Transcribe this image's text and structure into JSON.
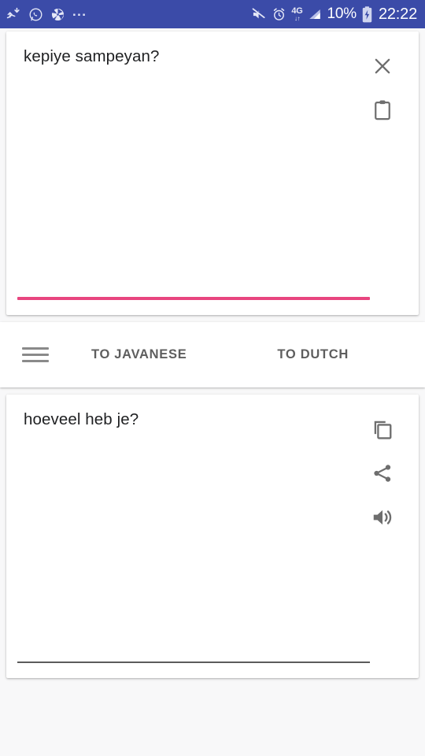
{
  "status_bar": {
    "background_color": "#3b4ba8",
    "left_icons": [
      {
        "name": "data-transfer-icon",
        "glyph": "data-transfer"
      },
      {
        "name": "whatsapp-icon",
        "glyph": "whatsapp"
      },
      {
        "name": "camera-shutter-icon",
        "glyph": "shutter"
      }
    ],
    "overflow_dots": "...",
    "right_icons": [
      {
        "name": "mute-icon",
        "glyph": "mute"
      },
      {
        "name": "alarm-clock-icon",
        "glyph": "alarm"
      }
    ],
    "network_type_top": "4G",
    "network_type_bottom": "↓↑",
    "signal_icon": "signal-bars-icon",
    "battery_percent": "10%",
    "battery_state": "charging",
    "clock": "22:22"
  },
  "source_card": {
    "text": "kepiye sampeyan?",
    "close_icon": "close-icon",
    "paste_icon": "clipboard-paste-icon",
    "underline_color": "#e8457f"
  },
  "toolbar": {
    "menu_icon": "hamburger-menu-icon",
    "to_source_label": "TO JAVANESE",
    "to_target_label": "TO DUTCH"
  },
  "target_card": {
    "text": "hoeveel heb je?",
    "copy_icon": "copy-icon",
    "share_icon": "share-icon",
    "speaker_icon": "speaker-volume-icon",
    "underline_color": "#5b5b5b"
  }
}
